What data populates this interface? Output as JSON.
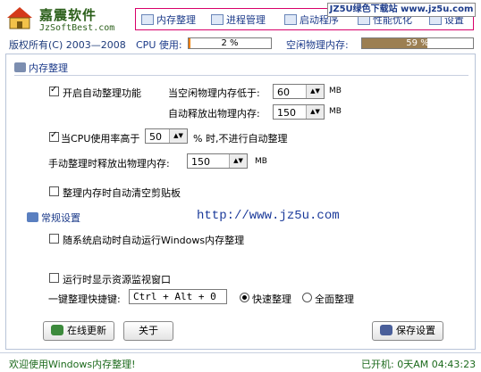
{
  "header": {
    "brand": "嘉震软件",
    "site": "JzSoftBest.com",
    "copyright": "版权所有(C) 2003—2008",
    "watermark": "JZ5U绿色下载站 www.jz5u.com"
  },
  "nav": {
    "items": [
      {
        "label": "内存整理",
        "icon": "memory-icon"
      },
      {
        "label": "进程管理",
        "icon": "process-icon"
      },
      {
        "label": "启动程序",
        "icon": "startup-icon"
      },
      {
        "label": "性能优化",
        "icon": "performance-icon"
      },
      {
        "label": "设置",
        "icon": "settings-icon"
      }
    ]
  },
  "usage": {
    "cpu_label": "CPU 使用:",
    "cpu_text": "2 %",
    "cpu_fraction": 0.02,
    "mem_label": "空闲物理内存:",
    "mem_text": "59 %",
    "mem_fraction": 0.59,
    "cpu_color": "#f08000",
    "mem_color": "#9c7f52"
  },
  "memory": {
    "title": "内存整理",
    "auto_enable": {
      "label": "开启自动整理功能",
      "checked": true
    },
    "threshold_label": "当空闲物理内存低于:",
    "threshold_value": "60",
    "threshold_unit": "MB",
    "release_label": "自动释放出物理内存:",
    "release_value": "150",
    "release_unit": "MB",
    "cpu_cond": {
      "label": "当CPU使用率高于",
      "checked": true
    },
    "cpu_value": "50",
    "cpu_suffix": "% 时,不进行自动整理",
    "manual_label": "手动整理时释放出物理内存:",
    "manual_value": "150",
    "manual_unit": "MB",
    "clipboard": {
      "label": "整理内存时自动清空剪贴板",
      "checked": false
    }
  },
  "general": {
    "title": "常规设置",
    "url": "http://www.jz5u.com",
    "autostart": {
      "label": "随系统启动时自动运行Windows内存整理",
      "checked": false
    },
    "monitor": {
      "label": "运行时显示资源监视窗口",
      "checked": false
    },
    "hotkey_label": "一键整理快捷键:",
    "hotkey_value": "Ctrl + Alt + 0",
    "quick_label": "快速整理",
    "full_label": "全面整理",
    "quick_selected": true
  },
  "buttons": {
    "online": "在线更新",
    "about": "关于",
    "save": "保存设置"
  },
  "status": {
    "welcome": "欢迎使用Windows内存整理!",
    "uptime": "已开机: 0天AM 04:43:23"
  }
}
